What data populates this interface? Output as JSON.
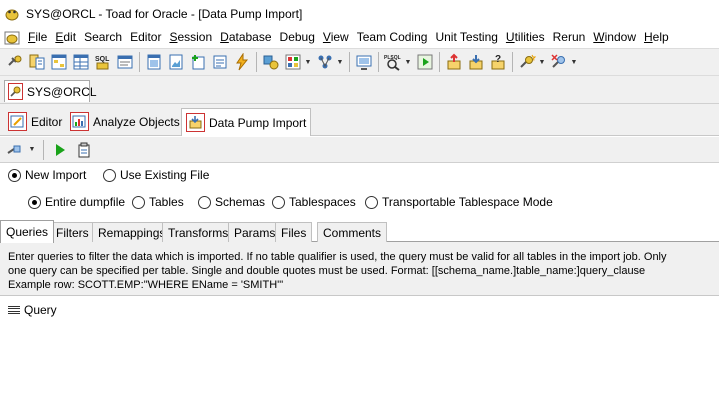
{
  "window": {
    "title": "SYS@ORCL - Toad for Oracle - [Data Pump Import]"
  },
  "menu": [
    {
      "u": "F",
      "rest": "ile"
    },
    {
      "u": "E",
      "rest": "dit"
    },
    {
      "u": "",
      "rest": "Search"
    },
    {
      "u": "",
      "rest": "Editor"
    },
    {
      "u": "S",
      "rest": "ession"
    },
    {
      "u": "D",
      "rest": "atabase"
    },
    {
      "u": "",
      "rest": "Debug"
    },
    {
      "u": "V",
      "rest": "iew"
    },
    {
      "u": "",
      "rest": "Team Coding"
    },
    {
      "u": "",
      "rest": "Unit Testing"
    },
    {
      "u": "U",
      "rest": "tilities"
    },
    {
      "u": "",
      "rest": "Rerun"
    },
    {
      "u": "W",
      "rest": "indow"
    },
    {
      "u": "H",
      "rest": "elp"
    }
  ],
  "toolbar": {
    "sql_label": "SQL",
    "plsql_label": "PLSQL"
  },
  "connection": {
    "label": "SYS@ORCL"
  },
  "doc_tabs": [
    {
      "label": "Editor"
    },
    {
      "label": "Analyze Objects"
    },
    {
      "label": "Data Pump Import"
    }
  ],
  "import_mode": {
    "options": [
      "New Import",
      "Use Existing File"
    ],
    "selected": "New Import"
  },
  "import_scope": {
    "options": [
      "Entire dumpfile",
      "Tables",
      "Schemas",
      "Tablespaces",
      "Transportable Tablespace Mode"
    ],
    "selected": "Entire dumpfile"
  },
  "sub_tabs": [
    "Queries",
    "Filters",
    "Remappings",
    "Transforms",
    "Params",
    "Files",
    "Comments"
  ],
  "queries": {
    "line1": "Enter queries to filter the data which is imported.  If no table qualifier is used, the query must be valid for all tables in the import job.  Only",
    "line2": "one query can be specified per table.  Single and double quotes must be used.  Format:    [[schema_name.]table_name:]query_clause",
    "line3": "Example row:    SCOTT.EMP:\"WHERE EName = 'SMITH'\"",
    "column_header": "Query"
  },
  "colors": {
    "toolbar_bg": "#f0f0f0",
    "accent_red": "#cc3333",
    "run_green": "#1aa31a"
  }
}
